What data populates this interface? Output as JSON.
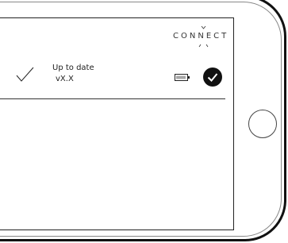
{
  "app": {
    "brand": "CONNECT"
  },
  "device_status": {
    "title": "Up to date",
    "version": "vX.X",
    "battery_icon": "battery-icon",
    "status_icon": "check-circle-icon"
  },
  "colors": {
    "foreground": "#111111",
    "background": "#ffffff"
  }
}
